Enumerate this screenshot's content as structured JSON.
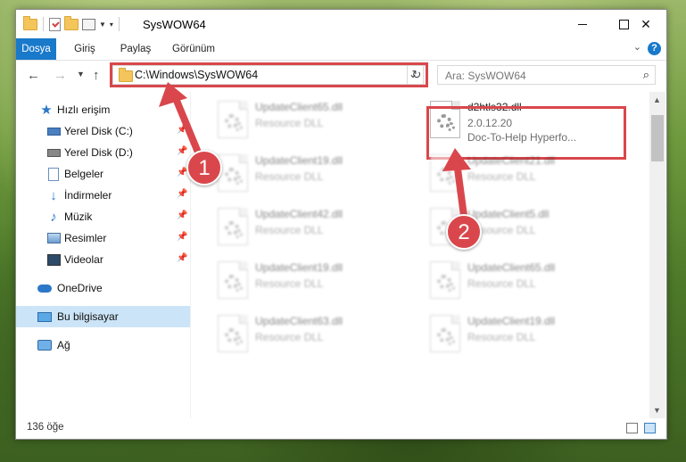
{
  "window": {
    "title": "SysWOW64"
  },
  "ribbon": {
    "tabs": [
      "Dosya",
      "Giriş",
      "Paylaş",
      "Görünüm"
    ],
    "active_tab": "Dosya"
  },
  "help_icon": "?",
  "address": {
    "path": "C:\\Windows\\SysWOW64"
  },
  "search": {
    "placeholder": "Ara: SysWOW64"
  },
  "sidebar": {
    "quick_access": "Hızlı erişim",
    "items": [
      "Yerel Disk (C:)",
      "Yerel Disk (D:)",
      "Belgeler",
      "İndirmeler",
      "Müzik",
      "Resimler",
      "Videolar"
    ],
    "onedrive": "OneDrive",
    "this_pc": "Bu bilgisayar",
    "network": "Ağ"
  },
  "files": [
    {
      "name": "UpdateClient65.dll",
      "type": "Resource DLL"
    },
    {
      "name": "d2htls32.dll",
      "version": "2.0.12.20",
      "description": "Doc-To-Help Hyperfo..."
    },
    {
      "name": "UpdateClient19.dll",
      "type": "Resource DLL"
    },
    {
      "name": "UpdateClient21.dll",
      "type": "Resource DLL"
    },
    {
      "name": "UpdateClient42.dll",
      "type": "Resource DLL"
    },
    {
      "name": "UpdateClient5.dll",
      "type": "Resource DLL"
    },
    {
      "name": "UpdateClient19.dll",
      "type": "Resource DLL"
    },
    {
      "name": "UpdateClient65.dll",
      "type": "Resource DLL"
    },
    {
      "name": "UpdateClient63.dll",
      "type": "Resource DLL"
    },
    {
      "name": "UpdateClient19.dll",
      "type": "Resource DLL"
    }
  ],
  "status": {
    "count": "136 öğe"
  },
  "annotations": {
    "step1": "1",
    "step2": "2"
  },
  "colors": {
    "accent": "#1979ca",
    "highlight": "#d9474c",
    "selected": "#cce4f7"
  },
  "icons": {
    "quick_access": "star-icon",
    "drive": "drive-icon",
    "documents": "document-icon",
    "downloads": "download-icon",
    "music": "music-icon",
    "pictures": "pictures-icon",
    "videos": "videos-icon",
    "onedrive": "cloud-icon",
    "this_pc": "computer-icon",
    "network": "network-icon",
    "file": "dll-file-icon"
  }
}
